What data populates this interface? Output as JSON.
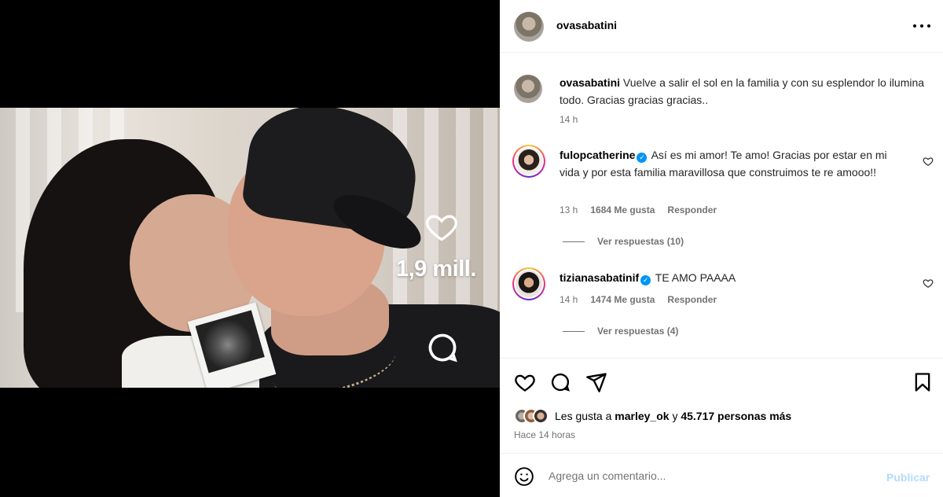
{
  "post": {
    "author": "ovasabatini",
    "caption_user": "ovasabatini",
    "caption_text": "Vuelve a salir el sol en la familia y con su esplendor lo ilumina todo. Gracias gracias gracias..",
    "caption_time": "14 h",
    "media_like_overlay": "1,9 mill."
  },
  "comments": [
    {
      "user": "fulopcatherine",
      "verified_icon": "✓",
      "text": "Así es mi amor! Te amo! Gracias por estar en mi vida y por esta familia maravillosa que construimos te re amooo!!",
      "time": "13 h",
      "likes": "1684 Me gusta",
      "reply_label": "Responder",
      "view_replies": "Ver respuestas (10)"
    },
    {
      "user": "tizianasabatinif",
      "verified_icon": "✓",
      "text": "TE AMO PAAAA",
      "time": "14 h",
      "likes": "1474 Me gusta",
      "reply_label": "Responder",
      "view_replies": "Ver respuestas (4)"
    }
  ],
  "engagement": {
    "likes_prefix": "Les gusta a",
    "likes_user": "marley_ok",
    "likes_and": "y",
    "likes_others": "45.717 personas más",
    "time_ago": "Hace 14 horas"
  },
  "composer": {
    "placeholder": "Agrega un comentario...",
    "publish_label": "Publicar"
  },
  "colors": {
    "link_blue": "#0095f6",
    "publish_disabled": "#b3dbff",
    "secondary_text": "#737373"
  }
}
